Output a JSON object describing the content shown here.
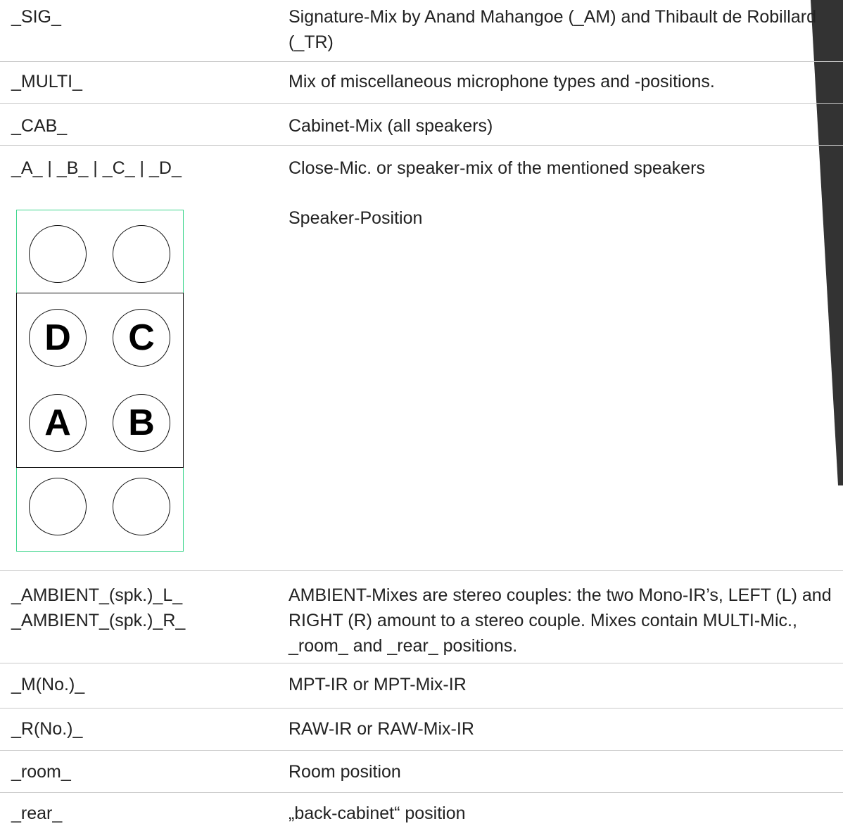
{
  "rows": [
    {
      "key_lines": [
        "_SIG_"
      ],
      "desc": "Signature-Mix by Anand Mahangoe (_AM) and Thibault de Robillard (_TR)"
    },
    {
      "key_lines": [
        "_MULTI_"
      ],
      "desc": "Mix of miscellaneous microphone types and -positions."
    },
    {
      "key_lines": [
        "_CAB_"
      ],
      "desc": "Cabinet-Mix (all speakers)"
    },
    {
      "key_lines": [
        "_A_ | _B_ | _C_ | _D_"
      ],
      "desc": "Close-Mic. or speaker-mix of the mentioned speakers"
    },
    {
      "key_lines": [],
      "desc": "Speaker-Position"
    },
    {
      "key_lines": [
        "_AMBIENT_(spk.)_L_",
        "_AMBIENT_(spk.)_R_"
      ],
      "desc": "AMBIENT-Mixes are stereo couples: the two Mono-IR’s, LEFT (L) and RIGHT (R) amount to a stereo couple. Mixes contain MULTI-Mic., _room_ and _rear_ positions."
    },
    {
      "key_lines": [
        "_M(No.)_"
      ],
      "desc": "MPT-IR or MPT-Mix-IR"
    },
    {
      "key_lines": [
        "_R(No.)_"
      ],
      "desc": "RAW-IR or RAW-Mix-IR"
    },
    {
      "key_lines": [
        "_room_"
      ],
      "desc": "Room position"
    },
    {
      "key_lines": [
        "_rear_"
      ],
      "desc": "„back-cabinet“ position"
    }
  ],
  "speaker_diagram": {
    "labels": {
      "top_left": "D",
      "top_right": "C",
      "bottom_left": "A",
      "bottom_right": "B"
    },
    "outline_color": "#3dd68c",
    "cabinet_color": "#111111"
  },
  "colors": {
    "text": "#222222",
    "divider": "#c9c9c9",
    "sidebar": "#333333"
  }
}
